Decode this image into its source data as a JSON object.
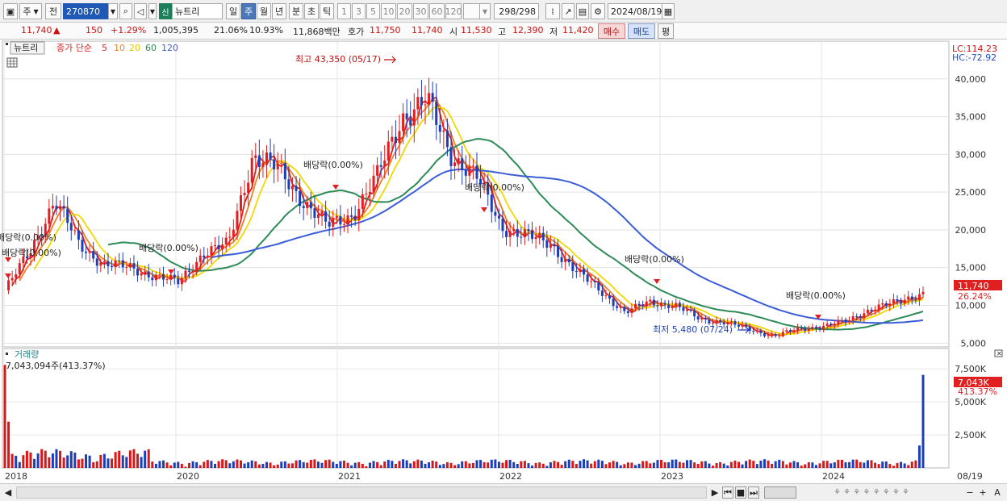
{
  "toolbar": {
    "period_label": "주",
    "prev_label": "전",
    "code": "270870",
    "new_badge": "신",
    "stock_name": "뉴트리",
    "period_tabs": [
      "일",
      "주",
      "월",
      "년",
      "분",
      "초",
      "틱"
    ],
    "active_period": "주",
    "interval_buttons": [
      "1",
      "3",
      "5",
      "10",
      "20",
      "30",
      "60",
      "120"
    ],
    "bar_count": "298",
    "bar_total": "/298",
    "date": "2024/08/19"
  },
  "quote": {
    "price": "11,740",
    "change_arrow": "▲",
    "change": "150",
    "change_pct": "+1.29%",
    "volume": "1,005,395",
    "ratio1": "21.06%",
    "ratio2": "10.93%",
    "amount": "11,868백만",
    "quote_label": "호가",
    "bid": "11,750",
    "ask": "11,740",
    "open_label": "시",
    "open": "11,530",
    "high_label": "고",
    "high": "12,390",
    "low_label": "저",
    "low": "11,420",
    "buy_label": "매수",
    "sell_label": "매도",
    "eval_label": "평"
  },
  "price_legend": {
    "name": "뉴트리",
    "label": "종가 단순",
    "periods": [
      "5",
      "10",
      "20",
      "60",
      "120"
    ],
    "colors": [
      "#e02020",
      "#f08020",
      "#f2d800",
      "#2e8b57",
      "#3b5ed8"
    ]
  },
  "price_scale": {
    "lc": "LC:114.23",
    "hc": "HC:-72.92",
    "current_value": "11,740",
    "current_pct": "26.24%",
    "ticks": [
      "40,000",
      "35,000",
      "30,000",
      "25,000",
      "20,000",
      "15,000",
      "10,000",
      "5,000"
    ]
  },
  "annotations": {
    "high": "최고 43,350 (05/17)",
    "low": "최저 5,480 (07/24)",
    "dividends": [
      "배당락(0.00%)",
      "배당락(0.00%)",
      "배당락(0.00%)",
      "배당락(0.00%)",
      "배당락(0.00%)",
      "배당락(0.00%)",
      "배당락(0.00%)"
    ]
  },
  "volume_panel": {
    "title": "거래량",
    "max_label": "7,043,094주(413.37%)",
    "current_value": "7,043K",
    "current_pct": "413.37%",
    "ticks": [
      "7,500K",
      "5,000K",
      "2,500K"
    ]
  },
  "x_axis": {
    "labels": [
      "2018",
      "2020",
      "2021",
      "2022",
      "2023",
      "2024"
    ],
    "end_label": "08/19"
  },
  "chart_data": {
    "type": "candlestick",
    "title": "뉴트리",
    "ylim": [
      4500,
      45000
    ],
    "price_series": {
      "dates": [
        "2018-01",
        "2018-04",
        "2018-07",
        "2018-10",
        "2019-01",
        "2019-04",
        "2019-07",
        "2019-10",
        "2020-01",
        "2020-04",
        "2020-06",
        "2020-07",
        "2020-09",
        "2020-10",
        "2020-12",
        "2021-02",
        "2021-04",
        "2021-05",
        "2021-07",
        "2021-09",
        "2021-10",
        "2021-12",
        "2022-02",
        "2022-04",
        "2022-06",
        "2022-08",
        "2022-10",
        "2022-12",
        "2023-02",
        "2023-04",
        "2023-06",
        "2023-08",
        "2023-10",
        "2023-12",
        "2024-02",
        "2024-04",
        "2024-06",
        "2024-08"
      ],
      "close": [
        12000,
        17000,
        24000,
        18000,
        15500,
        15000,
        14000,
        13000,
        17000,
        18000,
        30000,
        28000,
        24000,
        20500,
        22000,
        27000,
        35000,
        37000,
        30000,
        27000,
        20500,
        19200,
        18200,
        14500,
        12000,
        9000,
        10500,
        10000,
        8200,
        7800,
        6800,
        6000,
        6800,
        7300,
        7900,
        9800,
        10300,
        11740
      ]
    },
    "high_point": {
      "date": "2021-05-17",
      "value": 43350
    },
    "low_point": {
      "date": "2023-07-24",
      "value": 5480
    },
    "moving_averages": [
      "5",
      "10",
      "20",
      "60",
      "120"
    ],
    "volume_max": 7043094,
    "volume_ylim": [
      0,
      8000000
    ]
  }
}
